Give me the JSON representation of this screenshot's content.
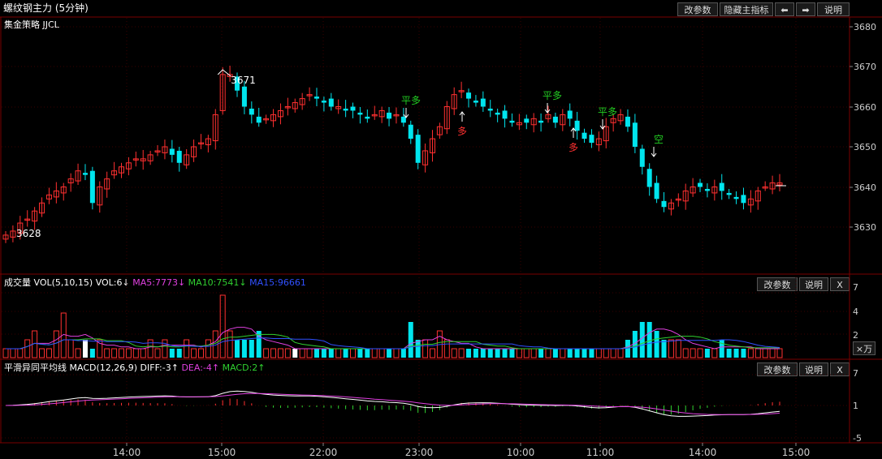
{
  "window": {
    "title": "螺纹钢主力 (5分钟)"
  },
  "toolbar": {
    "params_label": "改参数",
    "hide_indicator_label": "隐藏主指标",
    "prev_arrow": "⬅",
    "next_arrow": "➡",
    "help_label": "说明"
  },
  "main_panel": {
    "strategy_label": "集金策略 JJCL",
    "price_axis": [
      "3680",
      "3670",
      "3660",
      "3650",
      "3640",
      "3630"
    ],
    "high_marker": "3671",
    "low_marker": "3628",
    "signals": [
      {
        "text": "平多",
        "color": "#22cc22"
      },
      {
        "text": "多",
        "color": "#ff3030"
      },
      {
        "text": "平多",
        "color": "#22cc22"
      },
      {
        "text": "多",
        "color": "#ff3030"
      },
      {
        "text": "平多",
        "color": "#22cc22"
      },
      {
        "text": "空",
        "color": "#22cc22"
      }
    ]
  },
  "volume_panel": {
    "title": "成交量 VOL(5,10,15)",
    "vol_text": "VOL:6↓",
    "ma5_text": "MA5:7773↓",
    "ma10_text": "MA10:7541↓",
    "ma15_text": "MA15:96661",
    "params_label": "改参数",
    "help_label": "说明",
    "close_label": "X",
    "unit_label": "×万",
    "axis": [
      "7",
      "4",
      "2"
    ],
    "colors": {
      "ma5": "#e040e0",
      "ma10": "#30d030",
      "ma15": "#3050ff",
      "vol": "#ffffff"
    }
  },
  "macd_panel": {
    "title": "平滑异同平均线 MACD(12,26,9)",
    "diff_text": "DIFF:-3↑",
    "dea_text": "DEA:-4↑",
    "macd_text": "MACD:2↑",
    "params_label": "改参数",
    "help_label": "说明",
    "close_label": "X",
    "axis": [
      "7",
      "1",
      "-5"
    ],
    "colors": {
      "diff": "#ffffff",
      "dea": "#e040e0",
      "macd": "#30d030"
    }
  },
  "time_axis": [
    "14:00",
    "15:00",
    "22:00",
    "23:00",
    "10:00",
    "11:00",
    "14:00",
    "15:00"
  ],
  "colors": {
    "up": "#ff3030",
    "down": "#00e5ee",
    "grid": "#3a0000",
    "axis_text": "#cccccc"
  }
}
